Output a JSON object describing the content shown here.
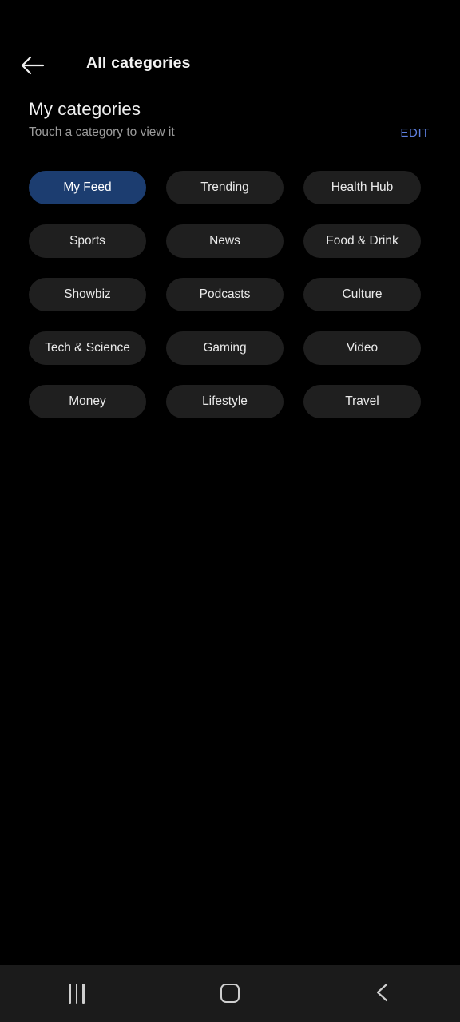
{
  "appbar": {
    "back_icon": "arrow-left-icon",
    "title": "All categories"
  },
  "section": {
    "title": "My categories",
    "subtitle": "Touch a category to view it",
    "edit_label": "EDIT"
  },
  "categories": [
    {
      "label": "My Feed",
      "selected": true
    },
    {
      "label": "Trending",
      "selected": false
    },
    {
      "label": "Health Hub",
      "selected": false
    },
    {
      "label": "Sports",
      "selected": false
    },
    {
      "label": "News",
      "selected": false
    },
    {
      "label": "Food & Drink",
      "selected": false
    },
    {
      "label": "Showbiz",
      "selected": false
    },
    {
      "label": "Podcasts",
      "selected": false
    },
    {
      "label": "Culture",
      "selected": false
    },
    {
      "label": "Tech & Science",
      "selected": false
    },
    {
      "label": "Gaming",
      "selected": false
    },
    {
      "label": "Video",
      "selected": false
    },
    {
      "label": "Money",
      "selected": false
    },
    {
      "label": "Lifestyle",
      "selected": false
    },
    {
      "label": "Travel",
      "selected": false
    }
  ],
  "navbar": {
    "recents_icon": "recents-icon",
    "home_icon": "home-icon",
    "back_icon": "chevron-left-icon"
  },
  "colors": {
    "background": "#000000",
    "chip": "#1f1f1f",
    "chip_selected": "#1c3d70",
    "accent": "#5e80e0",
    "navbar": "#1b1b1b",
    "text_primary": "#f0f0f0",
    "text_secondary": "#9b9b9b"
  }
}
